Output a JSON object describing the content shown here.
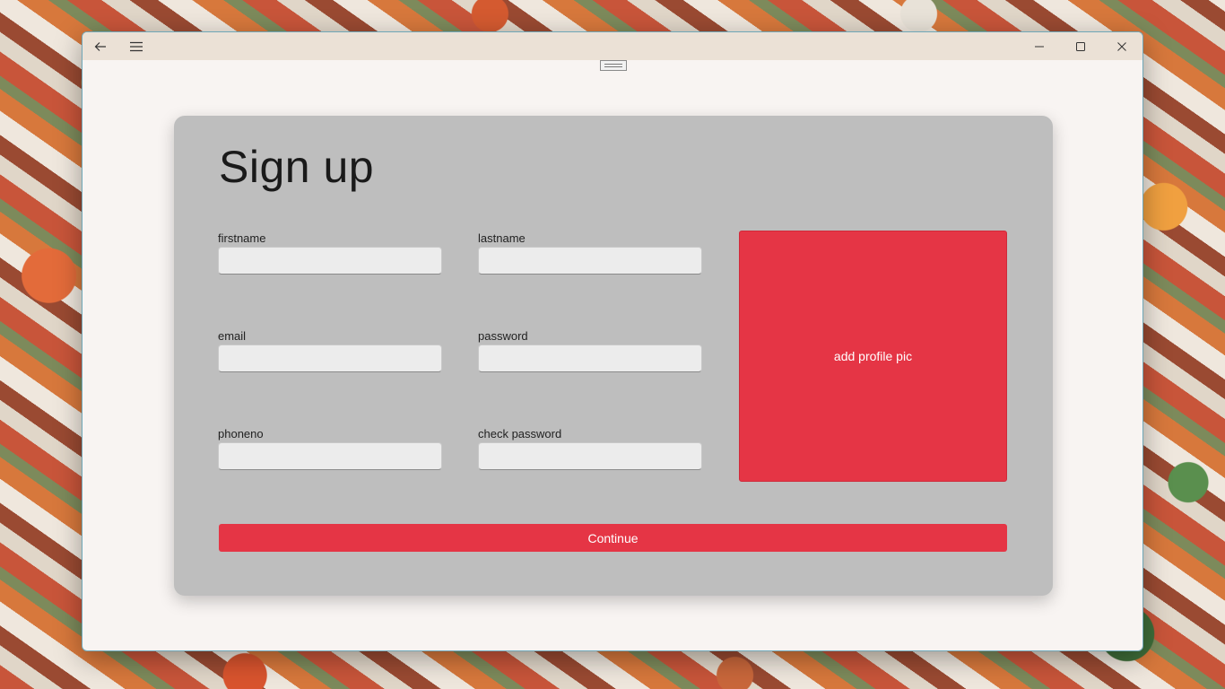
{
  "window": {
    "titlebar_icons": [
      "back-arrow-icon",
      "hamburger-menu-icon",
      "minimize-icon",
      "maximize-icon",
      "close-icon"
    ]
  },
  "form": {
    "title": "Sign up",
    "fields": {
      "firstname": {
        "label": "firstname",
        "value": ""
      },
      "lastname": {
        "label": "lastname",
        "value": ""
      },
      "email": {
        "label": "email",
        "value": ""
      },
      "password": {
        "label": "password",
        "value": ""
      },
      "phoneno": {
        "label": "phoneno",
        "value": ""
      },
      "check_password": {
        "label": "check password",
        "value": ""
      }
    },
    "profile_pic_label": "add profile pic",
    "continue_label": "Continue"
  },
  "colors": {
    "accent": "#e53545",
    "card": "#bebebe",
    "window_bg": "#f8f4f2",
    "titlebar": "#ebe1d6"
  }
}
